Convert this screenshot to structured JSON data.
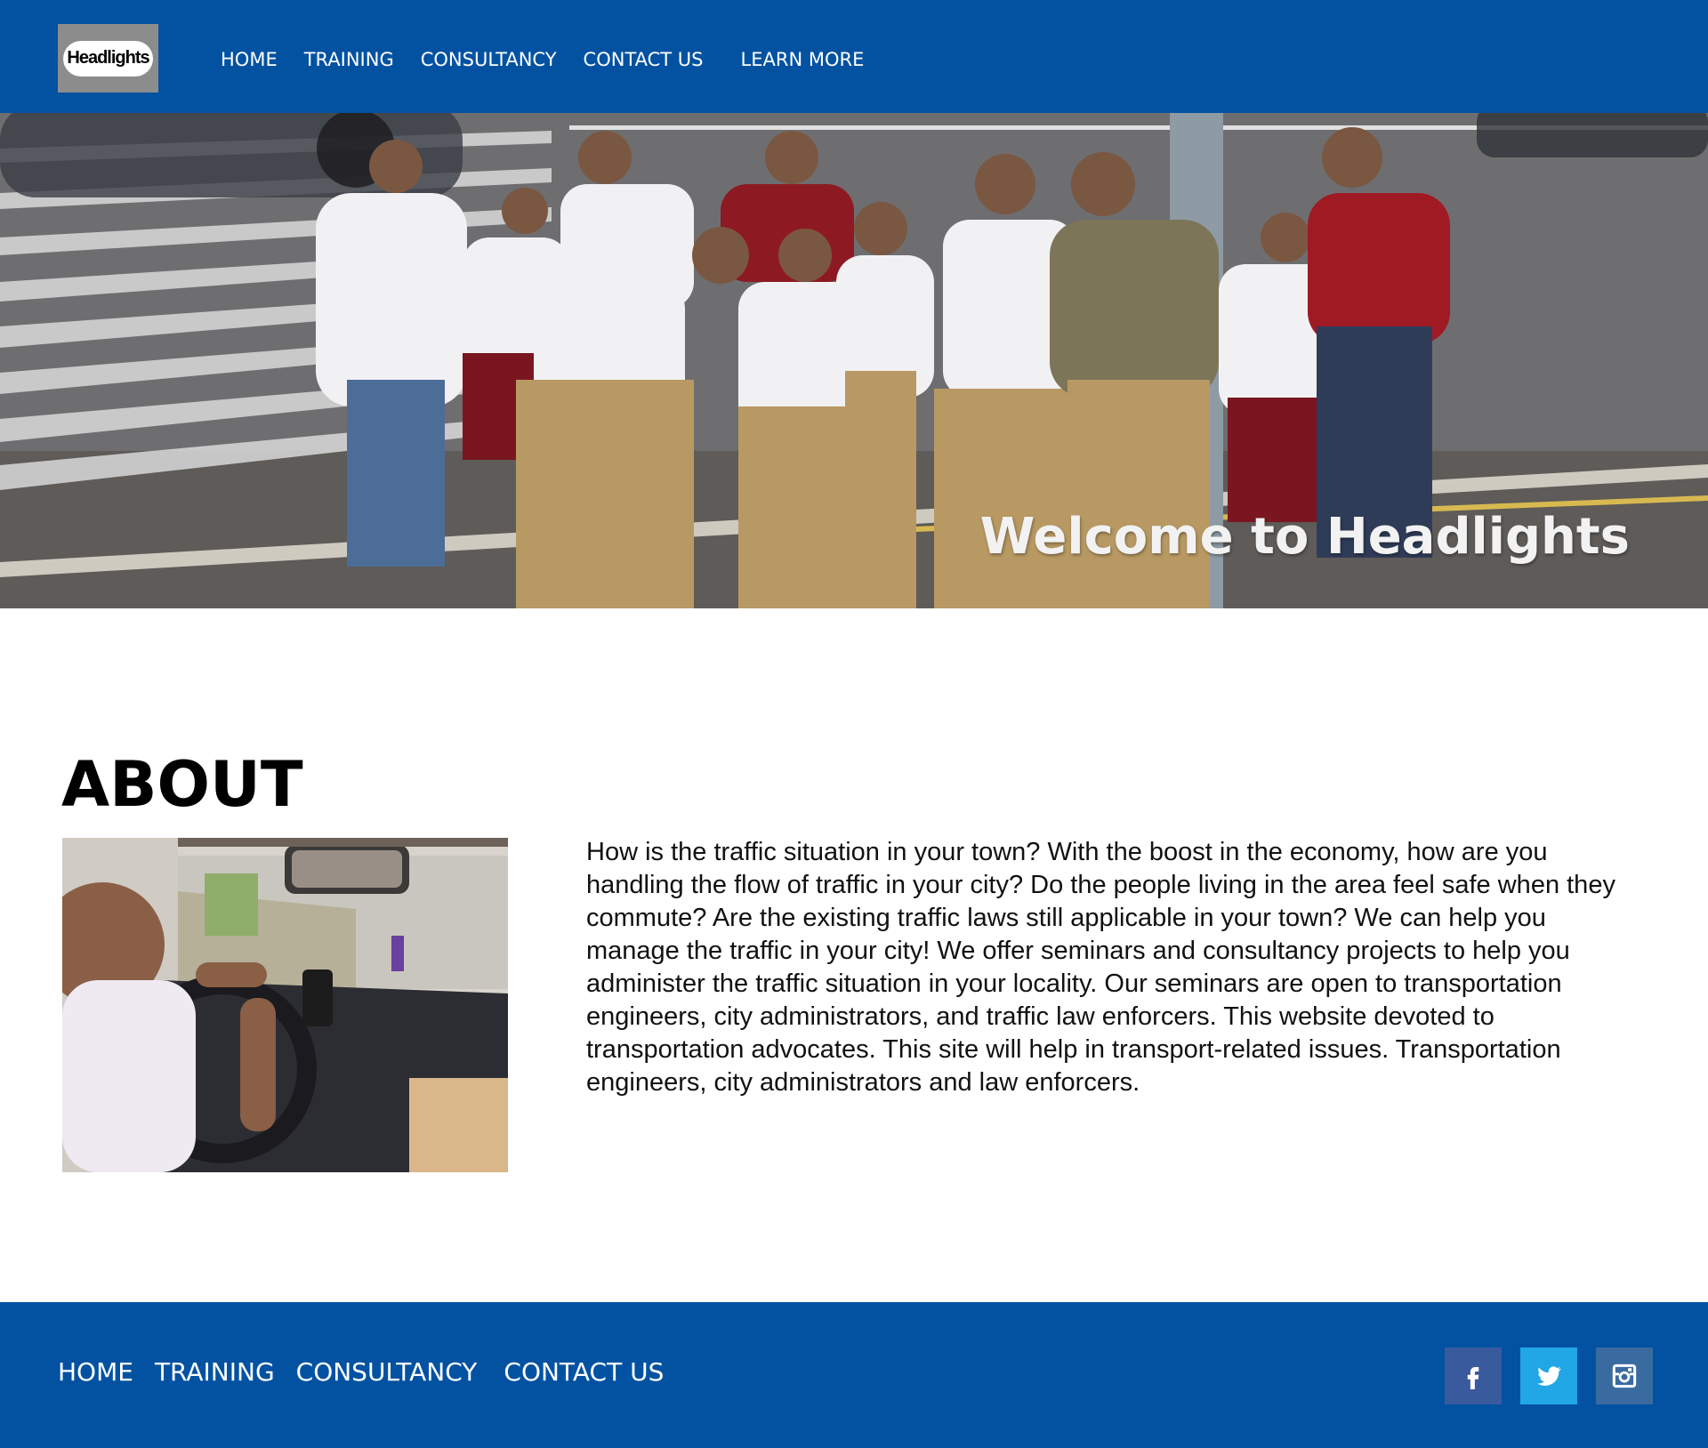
{
  "brand": {
    "logo_text": "Headlights"
  },
  "nav": {
    "home": "HOME",
    "training": "TRAINING",
    "consultancy": "CONSULTANCY",
    "contact": "CONTACT US",
    "learn_more": "LEARN MORE"
  },
  "hero": {
    "title": "Welcome to Headlights"
  },
  "about": {
    "heading": "ABOUT",
    "body": "How is the traffic situation in your town? With the boost in the economy, how are you handling the flow of traffic in your city? Do the people living in the area feel safe when they commute? Are the existing traffic laws still applicable in your town? We can help you manage the traffic in your city! We offer seminars and consultancy projects to help you administer the traffic situation in your locality. Our seminars are open to transportation engineers, city administrators, and traffic law enforcers. This website devoted to transportation advocates. This site will help in transport-related issues. Transportation engineers, city administrators and law enforcers."
  },
  "footer": {
    "nav": {
      "home": "HOME",
      "training": "TRAINING",
      "consultancy": "CONSULTANCY",
      "contact": "CONTACT US"
    },
    "social": {
      "facebook": "facebook-icon",
      "twitter": "twitter-icon",
      "instagram": "instagram-icon"
    }
  },
  "colors": {
    "brand_blue": "#0352a2",
    "facebook": "#3a5a9e",
    "twitter": "#22a7e6",
    "instagram": "#3a6ba0"
  }
}
